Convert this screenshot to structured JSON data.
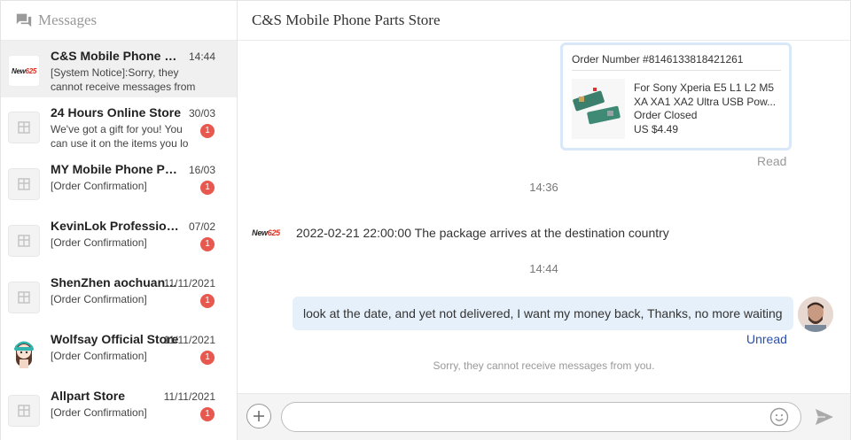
{
  "sidebar": {
    "title": "Messages",
    "conversations": [
      {
        "name": "C&S Mobile Phone Parts Store",
        "time": "14:44",
        "preview": "[System Notice]:Sorry, they cannot receive messages from you...",
        "badge": "",
        "avatar": "new625-logo"
      },
      {
        "name": "24 Hours Online Store",
        "time": "30/03",
        "preview": "We've got a gift for you! You can use it on the items you lo",
        "badge": "1",
        "avatar": "store-icon"
      },
      {
        "name": "MY Mobile Phone Parts Store",
        "time": "16/03",
        "preview": "[Order Confirmation]",
        "badge": "1",
        "avatar": "store-icon"
      },
      {
        "name": "KevinLok Professional Store",
        "time": "07/02",
        "preview": "[Order Confirmation]",
        "badge": "1",
        "avatar": "store-icon"
      },
      {
        "name": "ShenZhen aochuang Store",
        "time": "11/11/2021",
        "preview": "[Order Confirmation]",
        "badge": "1",
        "avatar": "store-icon"
      },
      {
        "name": "Wolfsay Official Store",
        "time": "11/11/2021",
        "preview": "[Order Confirmation]",
        "badge": "1",
        "avatar": "cartoon-girl-avatar"
      },
      {
        "name": "Allpart Store",
        "time": "11/11/2021",
        "preview": "[Order Confirmation]",
        "badge": "1",
        "avatar": "store-icon"
      }
    ]
  },
  "chat": {
    "title": "C&S Mobile Phone Parts Store",
    "order_card": {
      "order_number": "Order Number #8146133818421261",
      "product_line1": "For Sony Xperia E5 L1 L2 M5",
      "product_line2": "XA XA1 XA2 Ultra USB Pow...",
      "status": "Order Closed",
      "price": "US $4.49"
    },
    "read_label": "Read",
    "timestamp1": "14:36",
    "system_message": "2022-02-21 22:00:00 The package arrives at the destination country",
    "timestamp2": "14:44",
    "user_message": "look at the date, and yet not delivered, I want my money back, Thanks, no more waiting",
    "unread_label": "Unread",
    "notice": "Sorry, they cannot receive messages from you.",
    "logo_text_black": "New",
    "logo_text_red": "625"
  },
  "input": {
    "placeholder": "",
    "value": ""
  },
  "colors": {
    "badge": "#e8584f",
    "bubble": "#e6f0fa",
    "unread": "#2b4fa8",
    "card_border": "#d8e8f8"
  }
}
